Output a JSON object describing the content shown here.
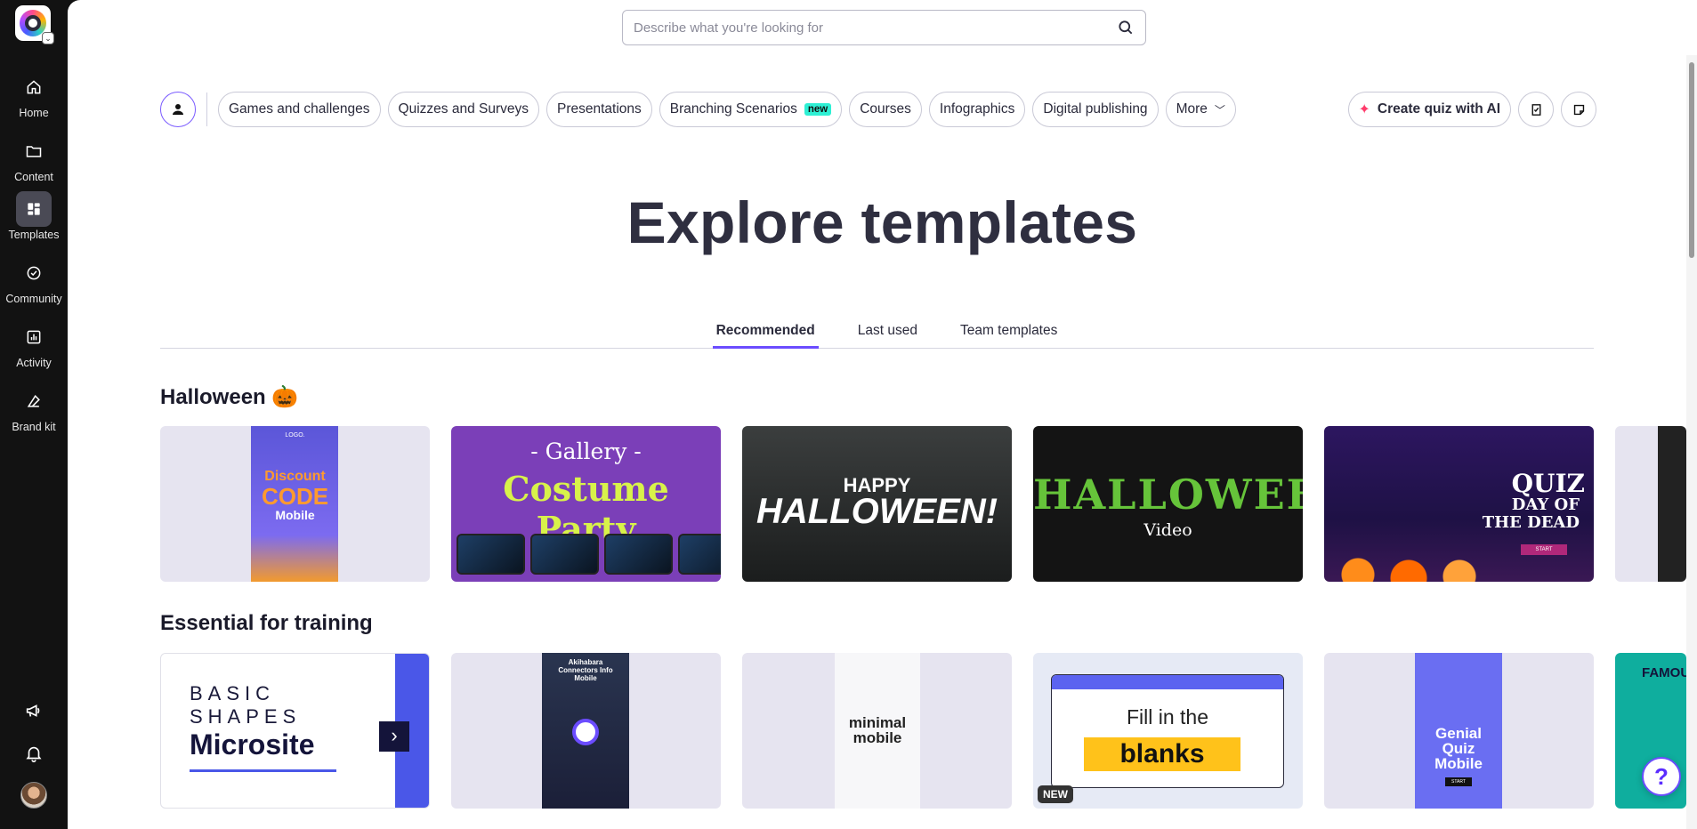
{
  "sidebar": {
    "items": [
      {
        "label": "Home",
        "icon": "home-icon"
      },
      {
        "label": "Content",
        "icon": "folder-icon"
      },
      {
        "label": "Templates",
        "icon": "templates-icon"
      },
      {
        "label": "Community",
        "icon": "community-icon"
      },
      {
        "label": "Activity",
        "icon": "activity-icon"
      },
      {
        "label": "Brand kit",
        "icon": "brand-kit-icon"
      }
    ],
    "active": "Templates"
  },
  "search": {
    "placeholder": "Describe what you're looking for"
  },
  "categories": [
    {
      "label": "Games and challenges"
    },
    {
      "label": "Quizzes and Surveys"
    },
    {
      "label": "Presentations"
    },
    {
      "label": "Branching Scenarios",
      "badge": "new"
    },
    {
      "label": "Courses"
    },
    {
      "label": "Infographics"
    },
    {
      "label": "Digital publishing"
    },
    {
      "label": "More"
    }
  ],
  "actions": {
    "create_ai": "Create quiz with AI"
  },
  "page_title": "Explore templates",
  "tabs": [
    "Recommended",
    "Last used",
    "Team templates"
  ],
  "sections": [
    {
      "title": "Halloween 🎃",
      "cards": [
        {
          "logo": "LOGO.",
          "line1": "Discount",
          "line2": "CODE",
          "line3": "Mobile"
        },
        {
          "line1": "- Gallery -",
          "line2": "Costume Party"
        },
        {
          "line1": "HAPPY",
          "line2": "HALLOWEEN!"
        },
        {
          "line1": "HALLOWEEN",
          "line2": "Video"
        },
        {
          "line1": "QUIZ",
          "line2": "DAY OF",
          "line3": "THE DEAD",
          "button": "START"
        }
      ]
    },
    {
      "title": "Essential for training",
      "cards": [
        {
          "line1": "BASIC",
          "line2": "SHAPES",
          "line3": "Microsite"
        },
        {
          "line1": "Akihabara Connectors Info Mobile"
        },
        {
          "line1": "minimal mobile"
        },
        {
          "line1": "Fill in the",
          "line2": "blanks",
          "tag": "NEW"
        },
        {
          "line1": "Genial Quiz Mobile",
          "button": "START"
        },
        {
          "line1": "FAMOU"
        }
      ]
    }
  ],
  "help": "?",
  "colors": {
    "accent": "#6b4cff",
    "sidebar": "#121212",
    "badge_new": "#2ef0d4"
  }
}
